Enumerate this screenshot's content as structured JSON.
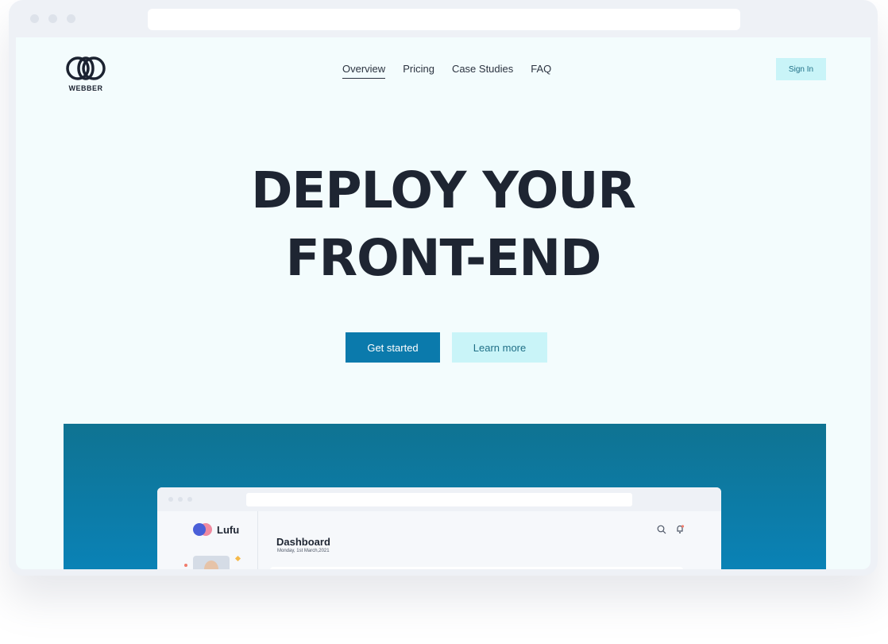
{
  "browser": {
    "url": ""
  },
  "brand": {
    "name": "WEBBER"
  },
  "nav": {
    "links": [
      "Overview",
      "Pricing",
      "Case Studies",
      "FAQ"
    ],
    "sign_in": "Sign In"
  },
  "hero": {
    "title_line1": "DEPLOY YOUR",
    "title_line2": "FRONT-END",
    "primary_cta": "Get started",
    "secondary_cta": "Learn more"
  },
  "preview": {
    "app_name": "Lufu",
    "dashboard_title": "Dashboard",
    "dashboard_date": "Monday, 1st March,2021",
    "icons": [
      "search-icon",
      "bell-icon"
    ]
  },
  "colors": {
    "primary": "#0b7aac",
    "secondary_bg": "#c9f4f8",
    "heading": "#1e2532",
    "page_bg": "#f3fcfd"
  }
}
